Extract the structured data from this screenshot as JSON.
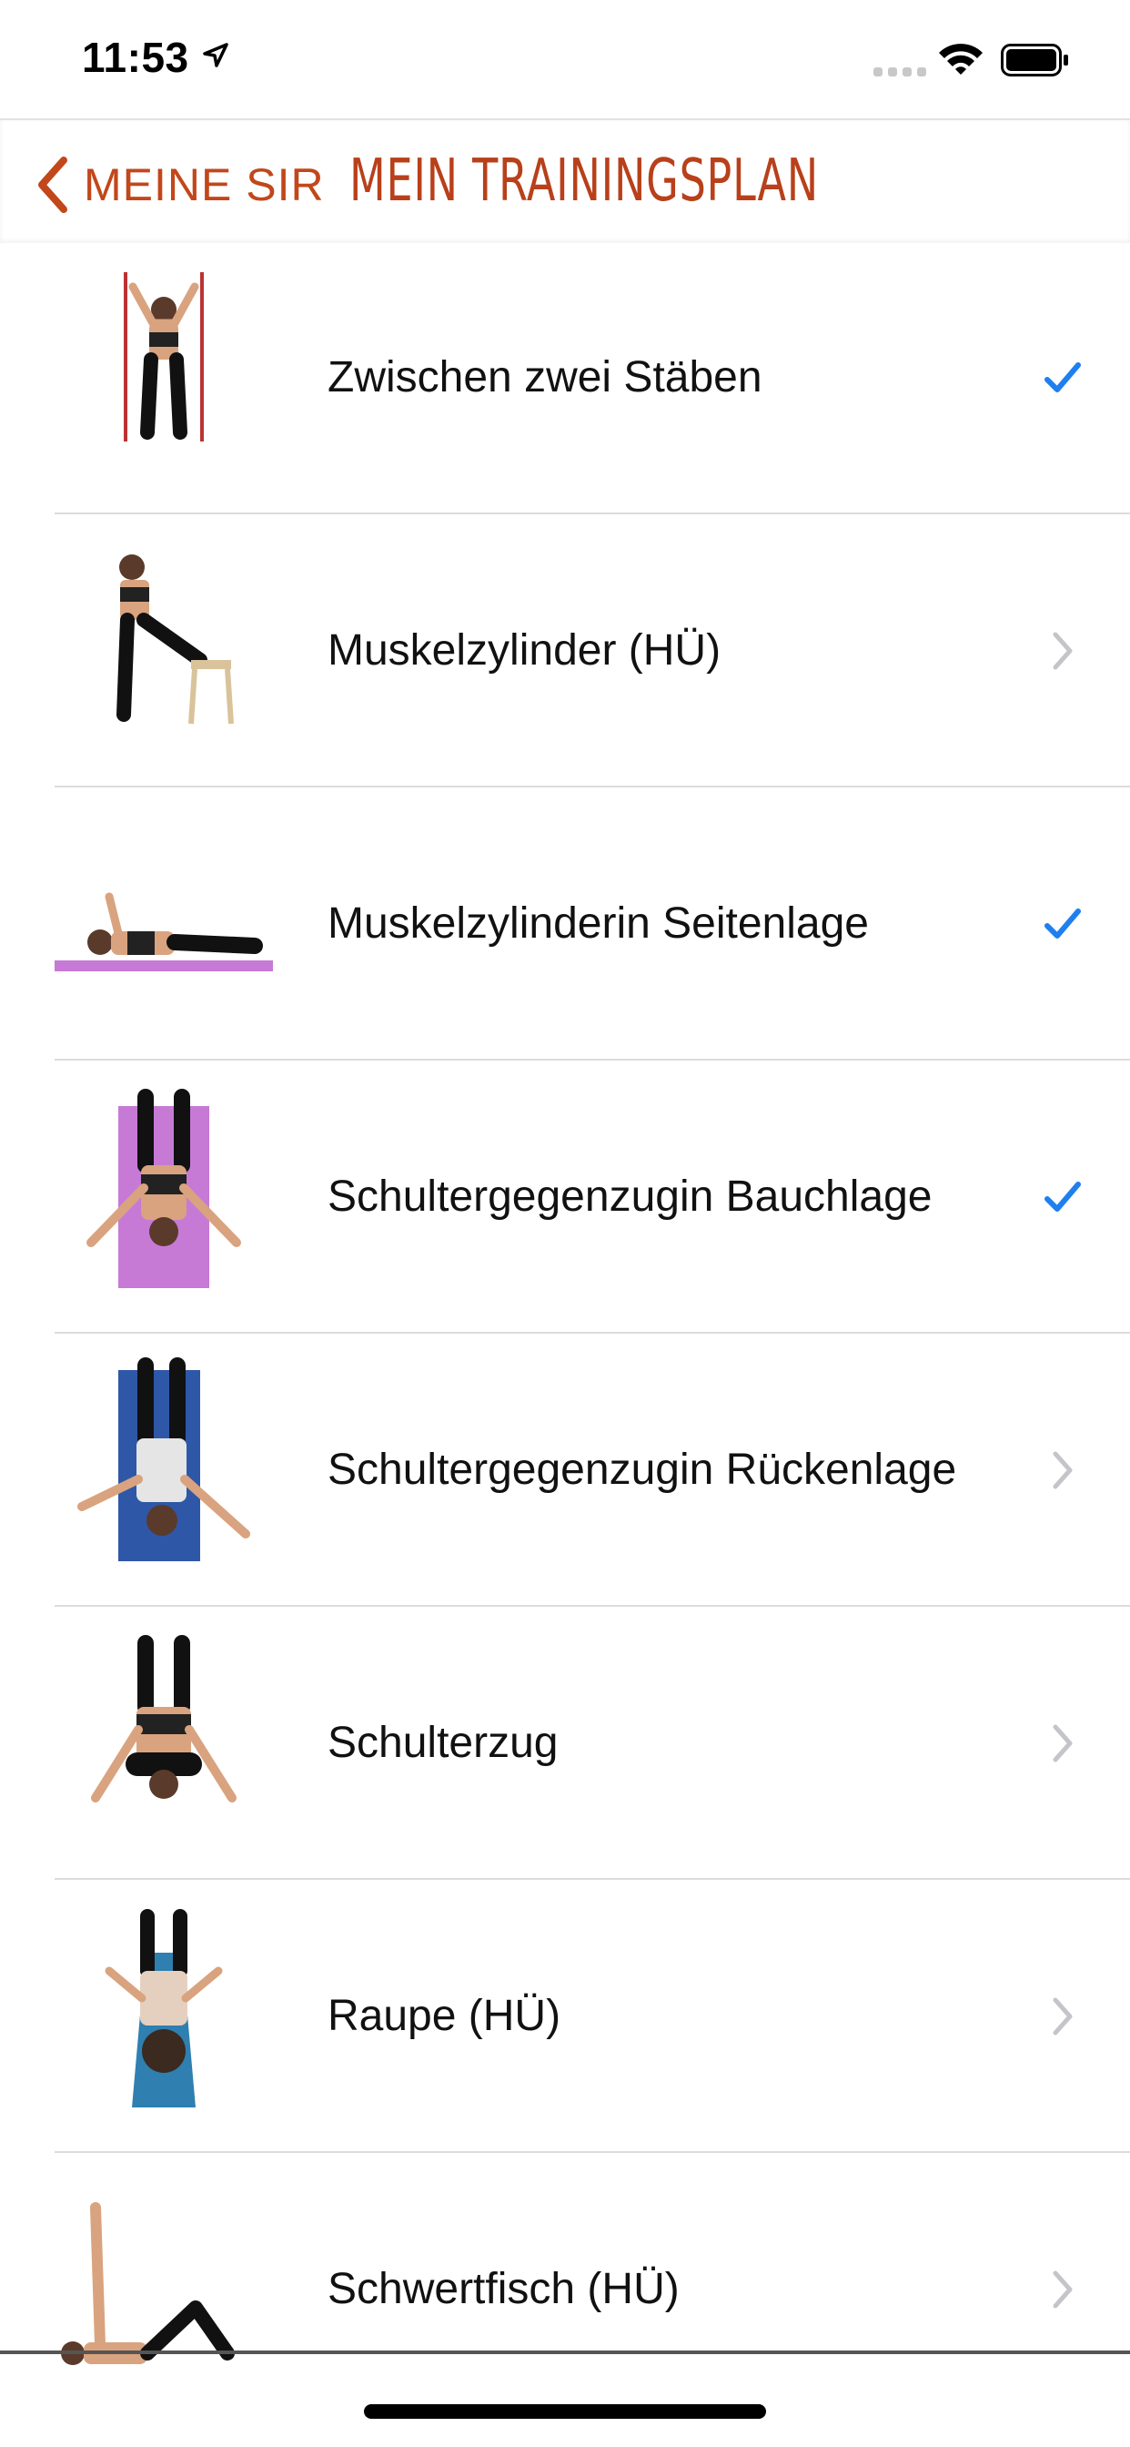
{
  "status_bar": {
    "time": "11:53"
  },
  "nav": {
    "back_label": "MEINE SIR",
    "title": "MEIN TRAININGSPLAN"
  },
  "colors": {
    "accent": "#c2471a",
    "check": "#1f7ff0",
    "chevron": "#c4c4c9"
  },
  "exercises": [
    {
      "line1": "Zwischen zwei Stäben",
      "line2": "",
      "accessory": "checkmark-icon",
      "pose": "standing-poles"
    },
    {
      "line1": "Muskelzylinder (HÜ)",
      "line2": "",
      "accessory": "chevron-right-icon",
      "pose": "standing-stool"
    },
    {
      "line1": "Muskelzylinder",
      "line2": "in Seitenlage",
      "accessory": "checkmark-icon",
      "pose": "side-lying"
    },
    {
      "line1": "Schultergegenzug",
      "line2": "in Bauchlage",
      "accessory": "checkmark-icon",
      "pose": "prone-mat"
    },
    {
      "line1": "Schultergegenzug",
      "line2": "in Rückenlage",
      "accessory": "chevron-right-icon",
      "pose": "supine-mat"
    },
    {
      "line1": "Schulterzug",
      "line2": "",
      "accessory": "chevron-right-icon",
      "pose": "prone-rolls"
    },
    {
      "line1": "Raupe (HÜ)",
      "line2": "",
      "accessory": "chevron-right-icon",
      "pose": "supine-blue-mat"
    },
    {
      "line1": "Schwertfisch (HÜ)",
      "line2": "",
      "accessory": "chevron-right-icon",
      "pose": "supine-leg-raise"
    }
  ]
}
